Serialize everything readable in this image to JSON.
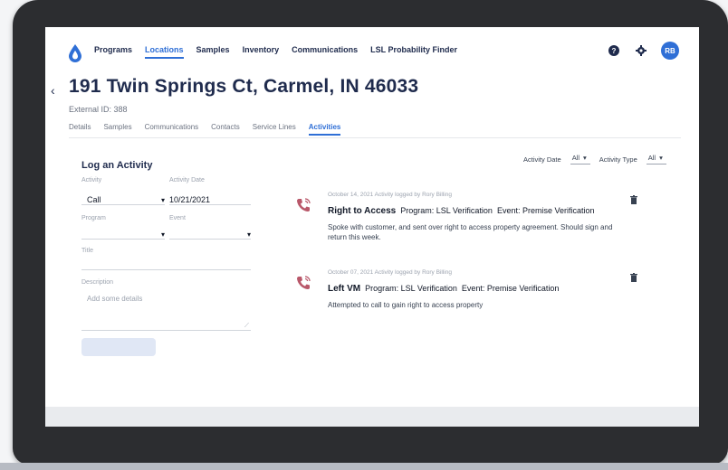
{
  "nav": {
    "items": [
      {
        "label": "Programs"
      },
      {
        "label": "Locations",
        "active": true
      },
      {
        "label": "Samples"
      },
      {
        "label": "Inventory"
      },
      {
        "label": "Communications"
      },
      {
        "label": "LSL Probability Finder"
      }
    ],
    "avatar_initials": "RB",
    "icons": [
      "help-icon",
      "gear-icon"
    ]
  },
  "page": {
    "title": "191 Twin Springs Ct, Carmel, IN 46033",
    "external_id": "External ID: 388"
  },
  "tabs": [
    {
      "label": "Details"
    },
    {
      "label": "Samples"
    },
    {
      "label": "Communications"
    },
    {
      "label": "Contacts"
    },
    {
      "label": "Service Lines"
    },
    {
      "label": "Activities",
      "active": true
    }
  ],
  "filters": {
    "activity_date_label": "Activity Date",
    "activity_date_value": "All",
    "activity_type_label": "Activity Type",
    "activity_type_value": "All"
  },
  "form": {
    "title": "Log an Activity",
    "activity_label": "Activity",
    "activity_value": "Call",
    "date_label": "Activity Date",
    "date_value": "10/21/2021",
    "program_label": "Program",
    "event_label": "Event",
    "title_label": "Title",
    "description_label": "Description",
    "description_placeholder": "Add some details"
  },
  "activities": [
    {
      "meta": "October 14, 2021 Activity logged by Rory Billing",
      "title": "Right to Access",
      "program": "Program: LSL Verification",
      "event": "Event: Premise Verification",
      "description": "Spoke with customer, and sent over right to access property agreement. Should sign and return this week."
    },
    {
      "meta": "October 07, 2021 Activity logged by Rory Billing",
      "title": "Left VM",
      "program": "Program: LSL Verification",
      "event": "Event: Premise Verification",
      "description": "Attempted to call to gain right to access property"
    }
  ],
  "colors": {
    "accent": "#2f6fd6",
    "call_icon": "#b9586a",
    "text_dark": "#1f2b4d"
  }
}
